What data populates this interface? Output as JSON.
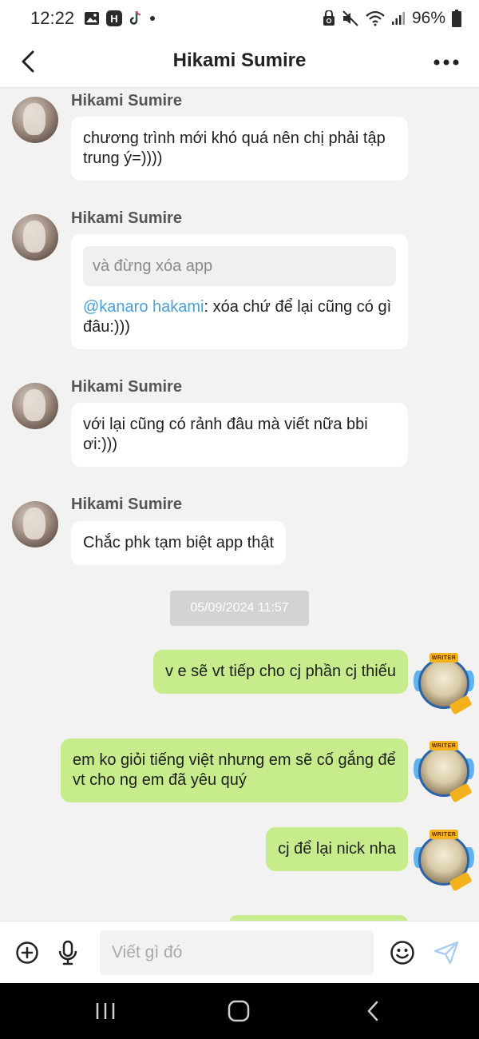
{
  "status_bar": {
    "time": "12:22",
    "battery": "96%",
    "left_icons": [
      "image-icon",
      "app-h-icon",
      "tiktok-icon",
      "dot-icon"
    ],
    "right_icons": [
      "lock-recycle-icon",
      "mute-icon",
      "wifi-icon",
      "signal-icon",
      "battery-icon"
    ]
  },
  "header": {
    "title": "Hikami Sumire",
    "back_icon": "chevron-left-icon",
    "menu_icon": "more-icon"
  },
  "messages": [
    {
      "direction": "in",
      "sender": "Hikami Sumire",
      "text": "chương trình mới khó quá nên chị phải tập trung ý=))))"
    },
    {
      "direction": "in",
      "sender": "Hikami Sumire",
      "quote": "và đừng xóa app",
      "mention": "@kanaro hakami",
      "text": ": xóa chứ để lại cũng có gì đâu:)))"
    },
    {
      "direction": "in",
      "sender": "Hikami Sumire",
      "text": "với lại cũng có rảnh đâu mà viết nữa bbi ơi:)))"
    },
    {
      "direction": "in",
      "sender": "Hikami Sumire",
      "text": "Chắc phk tạm biệt app thật"
    },
    {
      "direction": "out",
      "text": "v e sẽ vt tiếp cho cj phần cj thiếu"
    },
    {
      "direction": "out",
      "text": "em ko giỏi tiếng việt nhưng em sẽ cố gắng để vt cho ng em đã yêu quý"
    },
    {
      "direction": "out",
      "text": "cj để lại nick nha"
    }
  ],
  "timestamp": "05/09/2024 11:57",
  "avatar_badge": "WRITER",
  "input_bar": {
    "placeholder": "Viết gì đó",
    "value": "",
    "icons": [
      "add-circle-icon",
      "microphone-icon",
      "emoji-icon",
      "send-icon"
    ]
  },
  "nav_bar": {
    "icons": [
      "recents-icon",
      "home-icon",
      "back-icon"
    ]
  },
  "colors": {
    "outgoing_bubble": "#c6ec8c",
    "incoming_bubble": "#ffffff",
    "mention": "#4a9fd8",
    "send_icon": "#a9cdf0"
  }
}
